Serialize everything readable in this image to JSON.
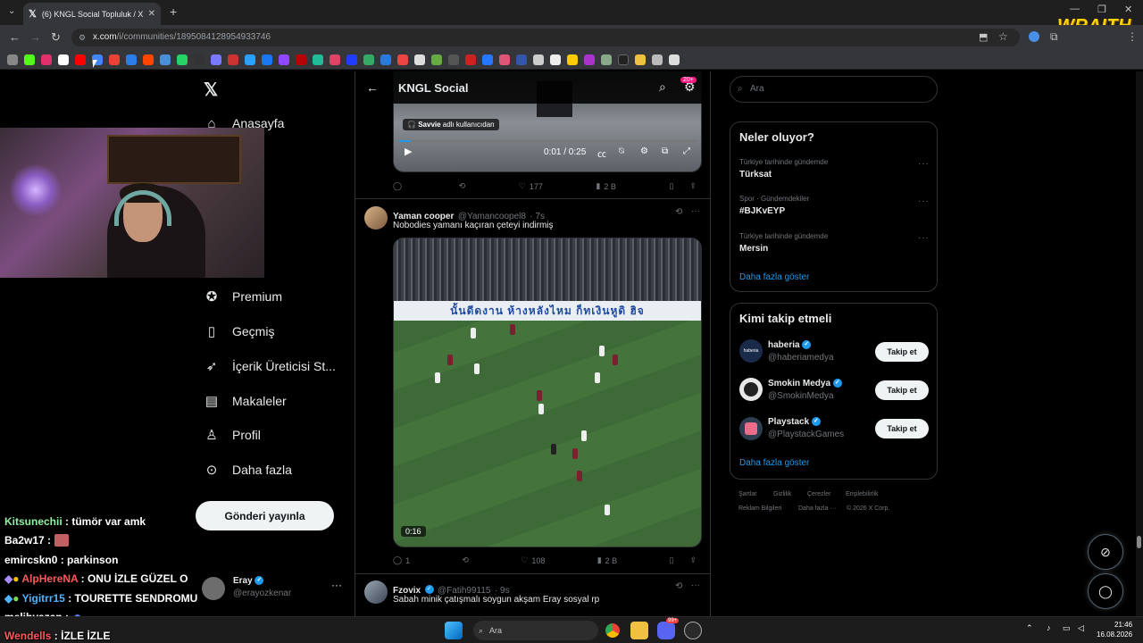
{
  "browser": {
    "tab_title": "(6) KNGL Social Topluluk / X",
    "url_host": "x.com",
    "url_path": "/i/communities/1895084128954933746",
    "wraith_logo": "WRAITH"
  },
  "sidebar": {
    "items": [
      {
        "label": "Anasayfa",
        "icon": "home-icon"
      },
      {
        "label": "Premium",
        "icon": "premium-icon"
      },
      {
        "label": "Geçmiş",
        "icon": "bookmark-icon"
      },
      {
        "label": "İçerik Üreticisi St...",
        "icon": "rocket-icon"
      },
      {
        "label": "Makaleler",
        "icon": "article-icon"
      },
      {
        "label": "Profil",
        "icon": "profile-icon"
      },
      {
        "label": "Daha fazla",
        "icon": "more-icon"
      }
    ],
    "post_button": "Gönderi yayınla",
    "account_name": "Eray",
    "account_handle": "@erayozkenar"
  },
  "chat": [
    {
      "user": "Kitsunechii",
      "msg": "tümör var amk",
      "color": "#8ef0a0"
    },
    {
      "user": "Ba2w17",
      "msg": "",
      "color": "#ffffff"
    },
    {
      "user": "emircskn0",
      "msg": "parkinson",
      "color": "#ffffff"
    },
    {
      "user": "AlpHereNA",
      "msg": "ONU İZLE GÜZEL O",
      "color": "#ff5a5a"
    },
    {
      "user": "Yigitrr15",
      "msg": "TOURETTE SENDROMU",
      "color": "#4fb4ff"
    },
    {
      "user": "melihyazan",
      "msg": "",
      "color": "#ffffff"
    },
    {
      "user": "Wendells",
      "msg": "İZLE İZLE",
      "color": "#ff5a5a"
    }
  ],
  "main": {
    "header_title": "KNGL Social",
    "badge": "20+",
    "video1": {
      "caption_user": "Savvie",
      "caption_rest": "adlı kullanıcıdan",
      "time": "0:01 / 0:25",
      "replies": "",
      "retweets": "",
      "likes": "177",
      "views": "2 B"
    },
    "tweet2": {
      "name": "Yaman cooper",
      "handle": "@Yamancoopel8",
      "time": "7s",
      "text": "Nobodies yamanı kaçıran çeteyi indirmiş",
      "banner": "นั้นดีดงาน ห้างหลังไหม ก็ทเงินหูดิ ฮิจ",
      "duration": "0:16",
      "replies": "1",
      "likes": "108",
      "views": "2 B"
    },
    "tweet3": {
      "name": "Fzovix",
      "handle": "@Fatih99115",
      "time": "9s",
      "text": "Sabah minik çatışmalı soygun akşam Eray sosyal rp"
    }
  },
  "right": {
    "search_placeholder": "Ara",
    "trends_title": "Neler oluyor?",
    "trends": [
      {
        "meta": "Türkiye tarihinde gündemde",
        "name": "Türksat"
      },
      {
        "meta": "Spor · Gündemdekiler",
        "name": "#BJKvEYP"
      },
      {
        "meta": "Türkiye tarihinde gündemde",
        "name": "Mersin"
      }
    ],
    "trends_more": "Daha fazla göster",
    "follow_title": "Kimi takip etmeli",
    "follow": [
      {
        "name": "haberia",
        "handle": "@haberiamedya",
        "btn": "Takip et",
        "avatar_text": "haberia"
      },
      {
        "name": "Smokin Medya",
        "handle": "@SmokinMedya",
        "btn": "Takip et",
        "avatar_text": ""
      },
      {
        "name": "Playstack",
        "handle": "@PlaystackGames",
        "btn": "Takip et",
        "avatar_text": ""
      }
    ],
    "follow_more": "Daha fazla göster",
    "footer": [
      "Şartlar",
      "Gizlilik",
      "Çerezler",
      "Erişilebilirlik",
      "Reklam Bilgileri",
      "Daha fazla ···",
      "© 2026 X Corp."
    ]
  },
  "taskbar": {
    "search": "Ara",
    "time": "21:46",
    "date": "16.08.2026",
    "discord_badge": "99+"
  }
}
